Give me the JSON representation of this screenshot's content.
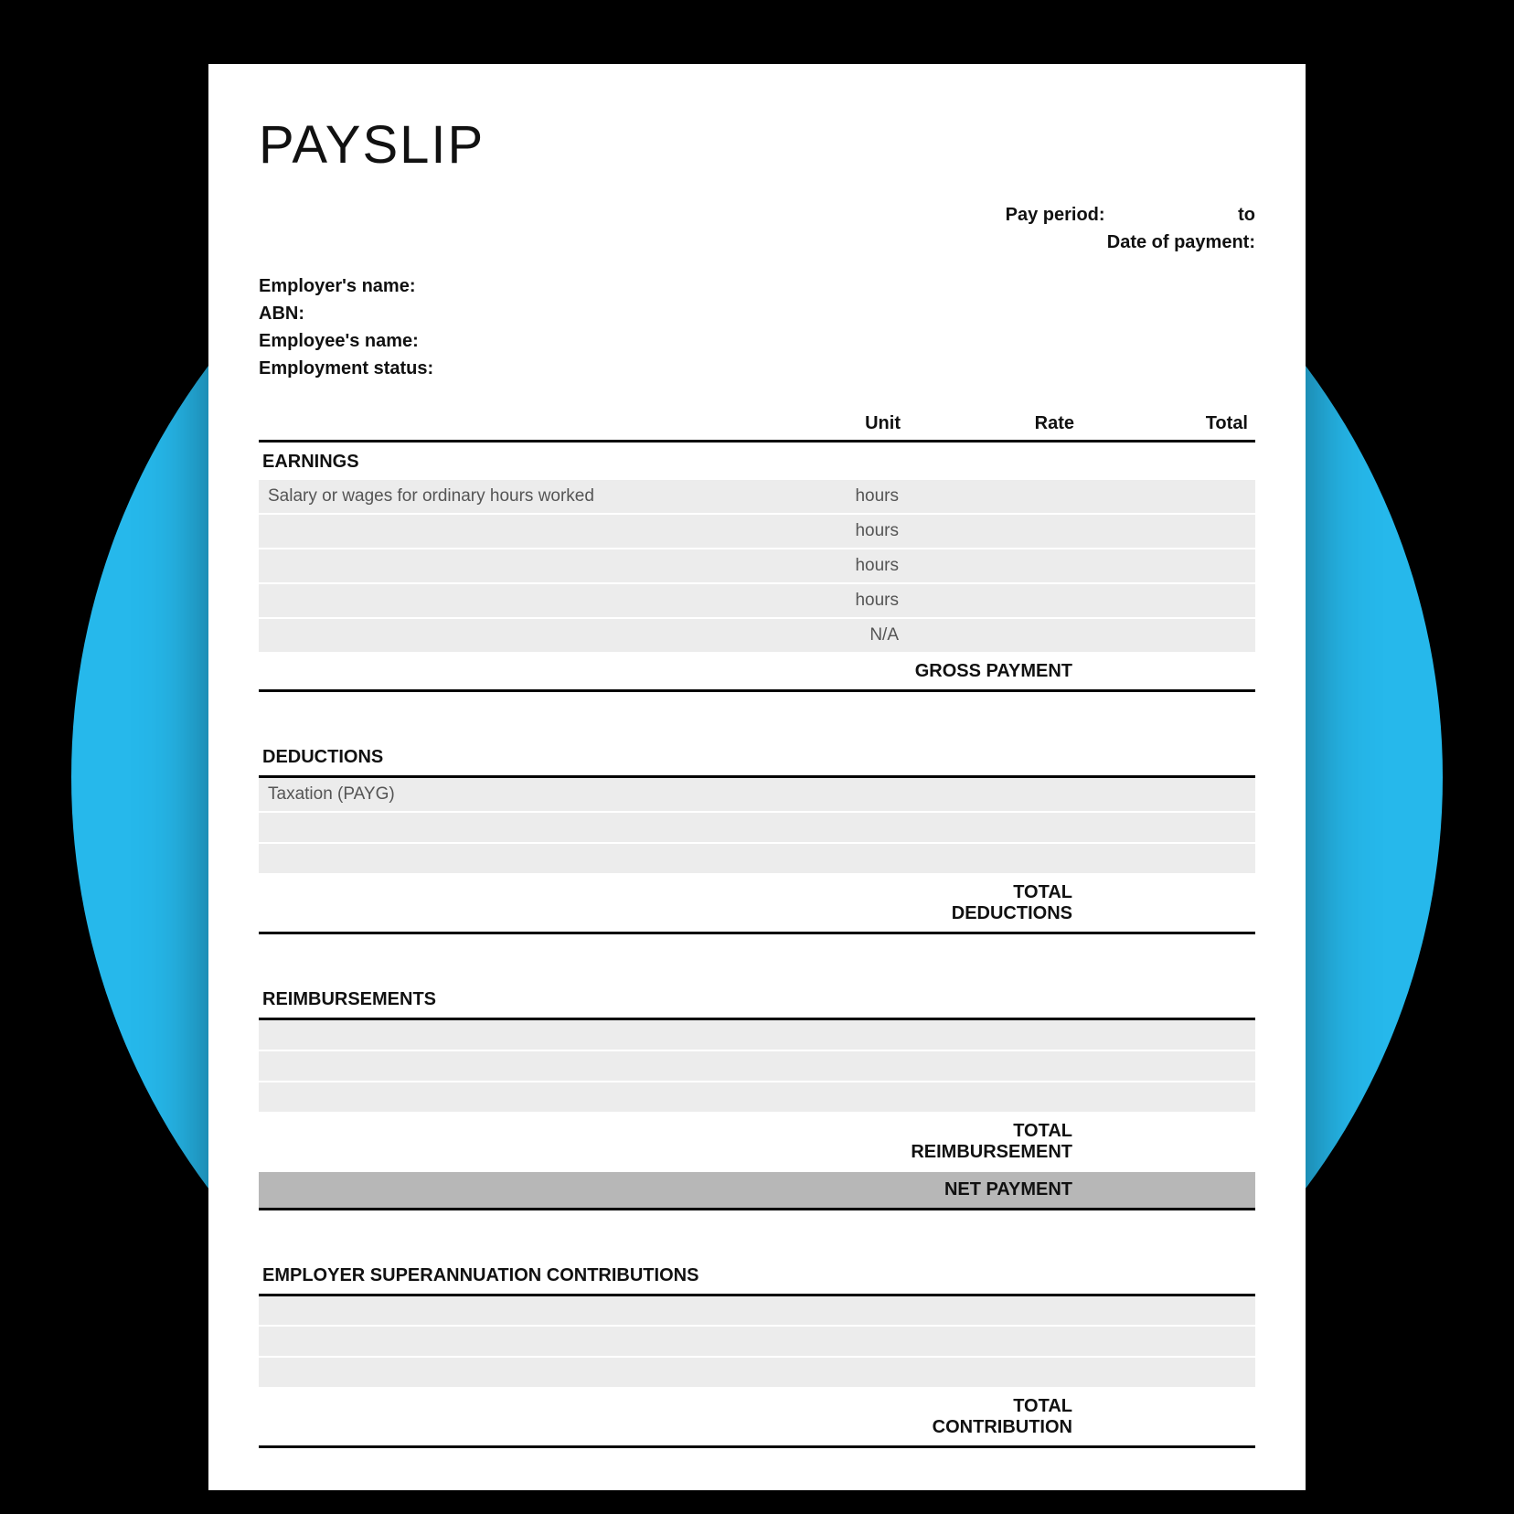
{
  "title": "PAYSLIP",
  "header": {
    "pay_period_label": "Pay period:",
    "pay_period_to": "to",
    "date_of_payment_label": "Date of payment:",
    "employer_name_label": "Employer's name:",
    "abn_label": "ABN:",
    "employee_name_label": "Employee's name:",
    "employment_status_label": "Employment status:"
  },
  "columns": {
    "unit": "Unit",
    "rate": "Rate",
    "total": "Total"
  },
  "earnings": {
    "heading": "EARNINGS",
    "rows": [
      {
        "desc": "Salary or wages for ordinary hours worked",
        "unit": "hours"
      },
      {
        "desc": "",
        "unit": "hours"
      },
      {
        "desc": "",
        "unit": "hours"
      },
      {
        "desc": "",
        "unit": "hours"
      },
      {
        "desc": "",
        "unit": "N/A"
      }
    ],
    "summary": "GROSS PAYMENT"
  },
  "deductions": {
    "heading": "DEDUCTIONS",
    "rows": [
      {
        "desc": "Taxation (PAYG)"
      },
      {
        "desc": ""
      },
      {
        "desc": ""
      }
    ],
    "summary": "TOTAL DEDUCTIONS"
  },
  "reimbursements": {
    "heading": "REIMBURSEMENTS",
    "rows": [
      {
        "desc": ""
      },
      {
        "desc": ""
      },
      {
        "desc": ""
      }
    ],
    "summary": "TOTAL REIMBURSEMENT",
    "net": "NET PAYMENT"
  },
  "super": {
    "heading": "EMPLOYER SUPERANNUATION CONTRIBUTIONS",
    "rows": [
      {
        "desc": ""
      },
      {
        "desc": ""
      },
      {
        "desc": ""
      }
    ],
    "summary": "TOTAL CONTRIBUTION"
  }
}
